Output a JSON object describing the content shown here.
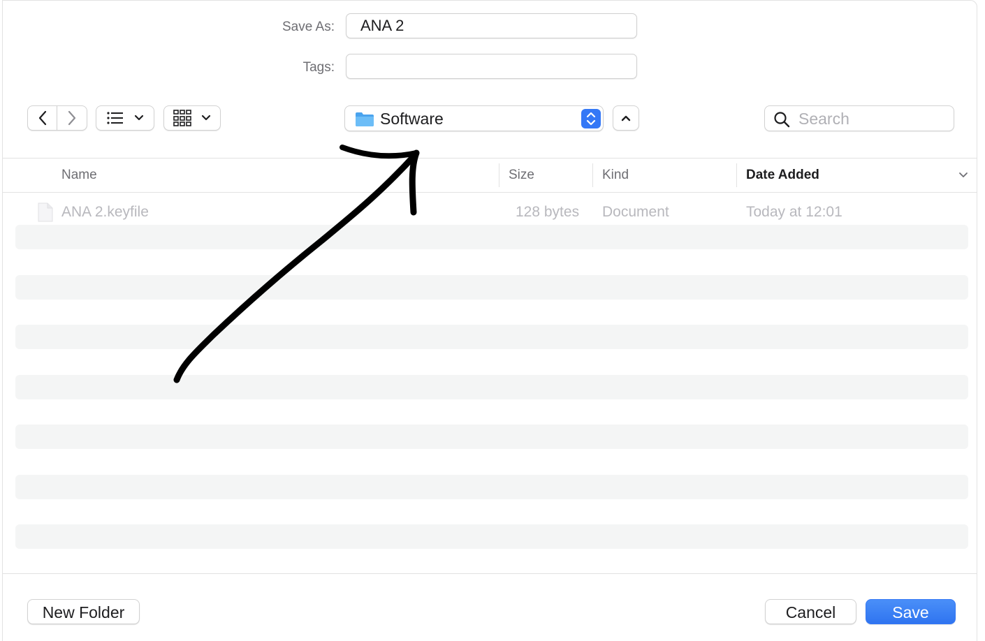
{
  "form": {
    "save_as_label": "Save As:",
    "save_as_value": "ANA 2",
    "tags_label": "Tags:",
    "tags_value": ""
  },
  "toolbar": {
    "back_icon": "chevron-left-icon",
    "forward_icon": "chevron-right-icon",
    "list_view_icon": "list-icon",
    "grid_view_icon": "grid-icon",
    "location": "Software",
    "location_icon": "folder-icon",
    "search_placeholder": "Search"
  },
  "columns": {
    "name": "Name",
    "size": "Size",
    "kind": "Kind",
    "date_added": "Date Added"
  },
  "files": [
    {
      "name": "ANA 2.keyfile",
      "size": "128 bytes",
      "kind": "Document",
      "date_added": "Today at 12:01"
    }
  ],
  "footer": {
    "new_folder": "New Folder",
    "cancel": "Cancel",
    "save": "Save"
  },
  "colors": {
    "accent": "#3478f6",
    "stripe": "#f4f5f5",
    "disabled_text": "#b8b8bd",
    "annotation": "#000000"
  }
}
